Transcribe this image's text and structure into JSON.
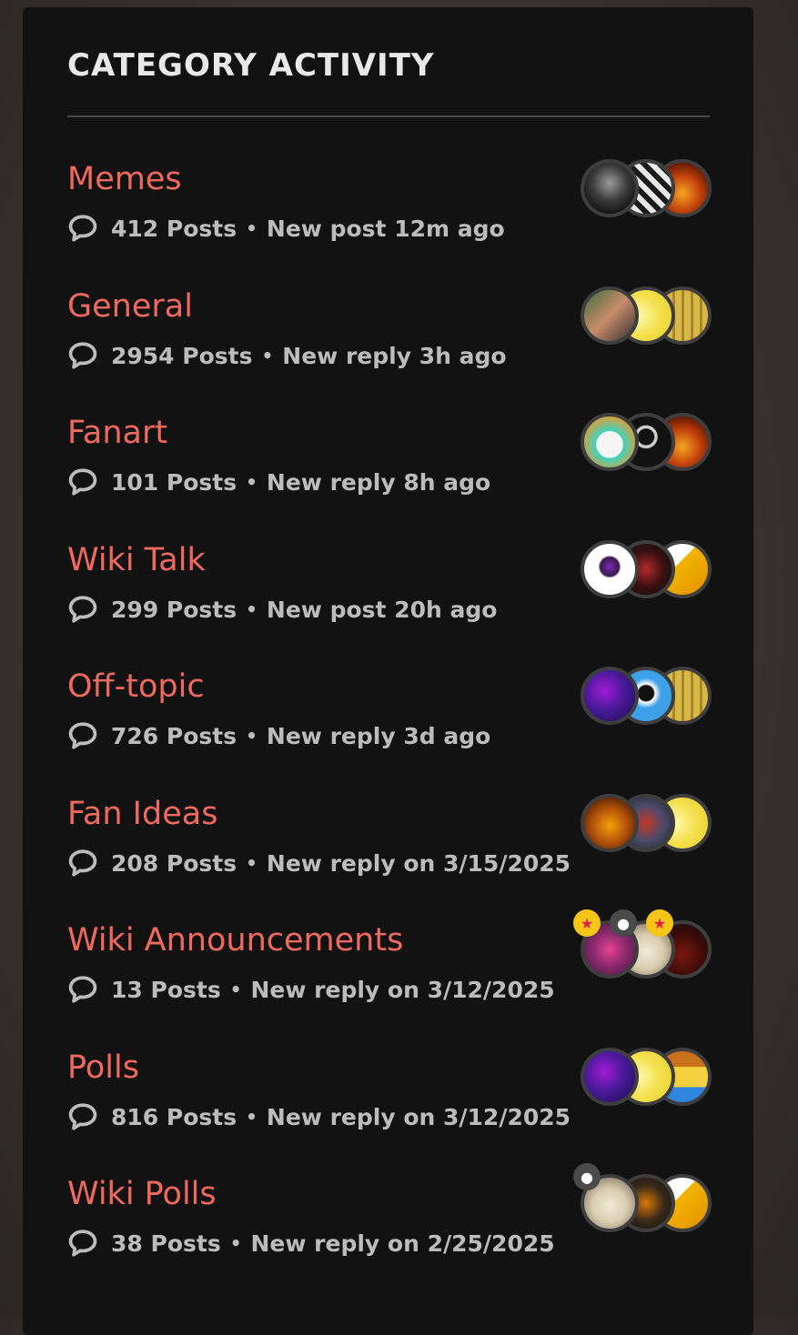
{
  "panel": {
    "title": "CATEGORY ACTIVITY"
  },
  "categories": [
    {
      "name": "Memes",
      "posts": "412 Posts",
      "activity": "New post 12m ago",
      "avatars": [
        {
          "bg": "radial-gradient(circle at 50% 40%, #9a9a9a 0%, #3a3a3a 45%, #111 80%)"
        },
        {
          "bg": "repeating-linear-gradient(45deg, #e8e8e8 0 6px, #1a1a1a 6px 12px)"
        },
        {
          "bg": "radial-gradient(circle at 50% 60%, #f5a623 0%, #c2410c 45%, #3b0a05 90%)"
        }
      ]
    },
    {
      "name": "General",
      "posts": "2954 Posts",
      "activity": "New reply 3h ago",
      "avatars": [
        {
          "bg": "linear-gradient(135deg, #3b6e3b 0%, #c98c6b 50%, #2f2f2f 100%)"
        },
        {
          "bg": "radial-gradient(circle at 35% 50%, #fff9b0 0%, #f4e04d 50%, #e8d030 100%)"
        },
        {
          "bg": "repeating-linear-gradient(90deg, #d9b84a 0 7px, #a8862a 7px 10px)"
        }
      ]
    },
    {
      "name": "Fanart",
      "posts": "101 Posts",
      "activity": "New reply 8h ago",
      "avatars": [
        {
          "bg": "radial-gradient(circle at 50% 55%, #f5f5f5 0%, #f5f5f5 35%, #3cd3c0 36%, #c8a64a 70%)"
        },
        {
          "bg": "radial-gradient(circle at 50% 40%, #121213 0%, #121213 20%, #cfcfcf 22%, #cfcfcf 28%, #121213 30%)",
          "placeholder": true
        },
        {
          "bg": "radial-gradient(circle at 50% 60%, #f5a623 0%, #c2410c 45%, #3b0a05 90%)"
        }
      ]
    },
    {
      "name": "Wiki Talk",
      "posts": "299 Posts",
      "activity": "New post 20h ago",
      "avatars": [
        {
          "bg": "radial-gradient(circle at 50% 45%, #7a2ab5 0%, #3a1a4a 25%, #ffffff 30%)"
        },
        {
          "bg": "radial-gradient(circle at 50% 50%, #b02a2a 0%, #3a1010 50%, #111 90%)"
        },
        {
          "bg": "linear-gradient(135deg, #ffffff 0%, #ffffff 40%, #f4b400 41%, #e09000 100%)"
        }
      ]
    },
    {
      "name": "Off-topic",
      "posts": "726 Posts",
      "activity": "New reply 3d ago",
      "avatars": [
        {
          "bg": "radial-gradient(circle at 40% 40%, #a21bd6 0%, #4a1a9a 45%, #1a0f4a 100%)"
        },
        {
          "bg": "radial-gradient(circle at 50% 45%, #111 0%, #111 20%, #ffffff 24%, #3da0e8 40%)"
        },
        {
          "bg": "repeating-linear-gradient(90deg, #d9b84a 0 7px, #a8862a 7px 10px)"
        }
      ]
    },
    {
      "name": "Fan Ideas",
      "posts": "208 Posts",
      "activity": "New reply on 3/15/2025",
      "avatars": [
        {
          "bg": "radial-gradient(circle at 50% 55%, #f59e0b 0%, #b4530a 45%, #3b1505 90%)"
        },
        {
          "bg": "radial-gradient(circle at 50% 50%, #c0392b 0%, #4a4a6a 50%, #222 100%)"
        },
        {
          "bg": "radial-gradient(circle at 35% 50%, #fff9b0 0%, #f4e04d 50%, #e8d030 100%)"
        }
      ]
    },
    {
      "name": "Wiki Announcements",
      "posts": "13 Posts",
      "activity": "New reply on 3/12/2025",
      "avatars": [
        {
          "bg": "radial-gradient(circle at 50% 50%, #e84393 0%, #8e2a6e 45%, #3a1a3a 100%)",
          "badge": "★",
          "badge_color": "#f5c518"
        },
        {
          "bg": "radial-gradient(circle at 50% 55%, #f2ead8 0%, #d8cdb0 45%, #6b5a4a 100%)",
          "badge": "●",
          "badge_color": "#4a4a4b"
        },
        {
          "bg": "radial-gradient(circle at 50% 60%, #7a1a10 0%, #3a0a08 55%, #111 100%)",
          "badge": "★",
          "badge_color": "#f5c518"
        }
      ]
    },
    {
      "name": "Polls",
      "posts": "816 Posts",
      "activity": "New reply on 3/12/2025",
      "avatars": [
        {
          "bg": "radial-gradient(circle at 40% 40%, #a21bd6 0%, #4a1a9a 45%, #1a0f4a 100%)"
        },
        {
          "bg": "radial-gradient(circle at 35% 50%, #fff9b0 0%, #f4e04d 50%, #e8d030 100%)"
        },
        {
          "bg": "linear-gradient(180deg, #c8701a 0%, #c8701a 30%, #f4d03f 31%, #f4d03f 70%, #2e86de 71%)"
        }
      ]
    },
    {
      "name": "Wiki Polls",
      "posts": "38 Posts",
      "activity": "New reply on 2/25/2025",
      "avatars": [
        {
          "bg": "radial-gradient(circle at 50% 55%, #f2ead8 0%, #d8cdb0 45%, #6b5a4a 100%)",
          "badge": "●",
          "badge_color": "#4a4a4b"
        },
        {
          "bg": "radial-gradient(circle at 50% 50%, #d97706 0%, #3a2a1a 50%, #111 100%)"
        },
        {
          "bg": "linear-gradient(135deg, #ffffff 0%, #ffffff 40%, #f4b400 41%, #e09000 100%)"
        }
      ]
    }
  ]
}
